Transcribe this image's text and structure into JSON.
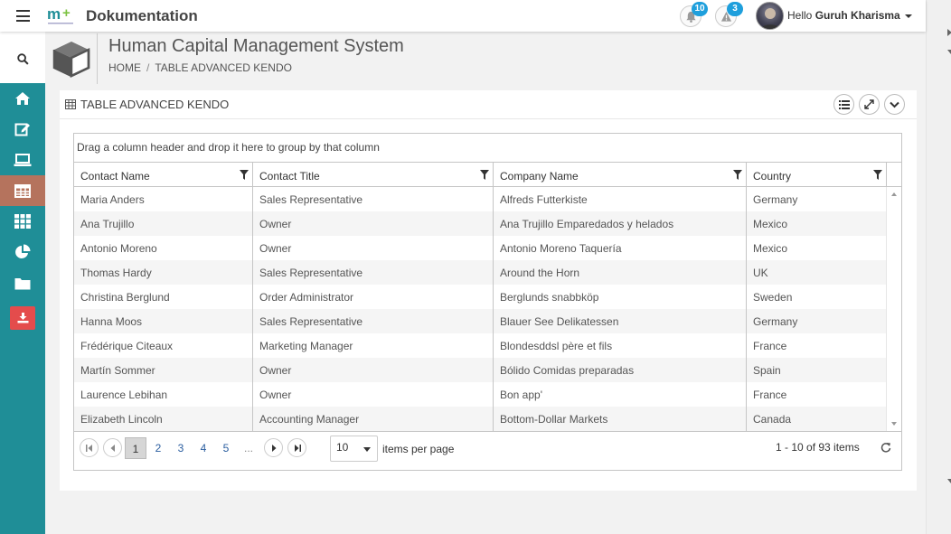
{
  "app": {
    "title": "Dokumentation"
  },
  "notifications": [
    {
      "icon": "bell-icon",
      "count": "10"
    },
    {
      "icon": "warning-icon",
      "count": "3"
    }
  ],
  "user": {
    "greeting": "Hello",
    "name": "Guruh Kharisma"
  },
  "sidebar": {
    "items": [
      {
        "icon": "home-icon"
      },
      {
        "icon": "edit-icon"
      },
      {
        "icon": "laptop-icon"
      },
      {
        "icon": "table-icon",
        "active": true
      },
      {
        "icon": "grid-icon"
      },
      {
        "icon": "pie-chart-icon"
      },
      {
        "icon": "folder-icon"
      },
      {
        "icon": "download-icon"
      }
    ]
  },
  "header": {
    "title": "Human Capital Management System",
    "breadcrumb": [
      "HOME",
      "/",
      "TABLE ADVANCED KENDO"
    ]
  },
  "panel": {
    "title": "TABLE ADVANCED KENDO",
    "group_hint": "Drag a column header and drop it here to group by that column",
    "columns": [
      "Contact Name",
      "Contact Title",
      "Company Name",
      "Country"
    ],
    "rows": [
      [
        "Maria Anders",
        "Sales Representative",
        "Alfreds Futterkiste",
        "Germany"
      ],
      [
        "Ana Trujillo",
        "Owner",
        "Ana Trujillo Emparedados y helados",
        "Mexico"
      ],
      [
        "Antonio Moreno",
        "Owner",
        "Antonio Moreno Taquería",
        "Mexico"
      ],
      [
        "Thomas Hardy",
        "Sales Representative",
        "Around the Horn",
        "UK"
      ],
      [
        "Christina Berglund",
        "Order Administrator",
        "Berglunds snabbköp",
        "Sweden"
      ],
      [
        "Hanna Moos",
        "Sales Representative",
        "Blauer See Delikatessen",
        "Germany"
      ],
      [
        "Frédérique Citeaux",
        "Marketing Manager",
        "Blondesddsl père et fils",
        "France"
      ],
      [
        "Martín Sommer",
        "Owner",
        "Bólido Comidas preparadas",
        "Spain"
      ],
      [
        "Laurence Lebihan",
        "Owner",
        "Bon app'",
        "France"
      ],
      [
        "Elizabeth Lincoln",
        "Accounting Manager",
        "Bottom-Dollar Markets",
        "Canada"
      ]
    ],
    "pager": {
      "pages": [
        "1",
        "2",
        "3",
        "4",
        "5",
        "..."
      ],
      "current": "1",
      "page_size": "10",
      "items_label": "items per page",
      "info": "1 - 10 of 93 items"
    }
  },
  "colors": {
    "sidebar": "#1f8e97",
    "active": "#b5735d",
    "badge": "#1e9fdc",
    "download": "#e44c4c"
  }
}
